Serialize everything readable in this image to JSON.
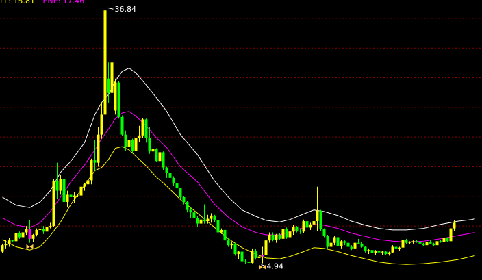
{
  "legend": {
    "items": [
      {
        "label": "LL: 15.81",
        "color": "#ffff00"
      },
      {
        "label": "ENE: 17.46",
        "color": "#ff00ff"
      }
    ]
  },
  "chart_data": {
    "type": "candlestick",
    "ylim": [
      3.2,
      37.8
    ],
    "grid": true,
    "colors": {
      "up": "#ffff00",
      "down": "#00ff00",
      "upper_band": "#ffffff",
      "middle_band": "#ff00ff",
      "lower_band": "#ffff00",
      "grid": "#8b0000",
      "signal": "#ff00ff"
    },
    "annotations": {
      "max": {
        "label": "36.84",
        "value": 36.84,
        "index": 30
      },
      "min": {
        "label": "4.94",
        "value": 4.94,
        "index": 76
      }
    },
    "signal_marks": [
      8,
      76
    ],
    "candles": [
      [
        6.4,
        7.4,
        6.2,
        7.2
      ],
      [
        7.2,
        7.9,
        6.8,
        7.3
      ],
      [
        7.3,
        8.1,
        7.0,
        7.8
      ],
      [
        7.8,
        7.9,
        7.6,
        7.7
      ],
      [
        7.7,
        8.9,
        7.5,
        8.7
      ],
      [
        8.7,
        8.9,
        8.0,
        8.2
      ],
      [
        8.2,
        9.0,
        8.0,
        8.8
      ],
      [
        8.8,
        9.6,
        8.5,
        9.2
      ],
      [
        9.2,
        10.3,
        7.5,
        8.0
      ],
      [
        8.0,
        8.6,
        7.6,
        8.5
      ],
      [
        8.5,
        9.3,
        8.3,
        9.1
      ],
      [
        9.1,
        9.5,
        8.9,
        9.2
      ],
      [
        9.2,
        9.6,
        8.6,
        8.9
      ],
      [
        8.9,
        9.6,
        8.8,
        9.5
      ],
      [
        9.5,
        10.0,
        9.3,
        9.6
      ],
      [
        9.6,
        15.5,
        9.5,
        15.2
      ],
      [
        15.2,
        17.5,
        13.0,
        14.0
      ],
      [
        14.0,
        16.0,
        13.5,
        15.5
      ],
      [
        15.5,
        15.6,
        12.3,
        12.6
      ],
      [
        12.6,
        14.0,
        12.0,
        13.5
      ],
      [
        13.5,
        14.2,
        13.0,
        13.2
      ],
      [
        13.2,
        13.8,
        12.5,
        13.4
      ],
      [
        13.4,
        13.6,
        13.2,
        13.4
      ],
      [
        13.4,
        15.0,
        13.0,
        14.5
      ],
      [
        14.5,
        15.0,
        14.0,
        14.8
      ],
      [
        14.8,
        15.5,
        14.5,
        15.3
      ],
      [
        15.3,
        18.0,
        14.8,
        17.8
      ],
      [
        17.8,
        20.3,
        16.5,
        17.5
      ],
      [
        17.5,
        22.0,
        17.0,
        21.0
      ],
      [
        21.0,
        25.0,
        20.5,
        23.5
      ],
      [
        23.5,
        37.0,
        23.0,
        36.5
      ],
      [
        28.0,
        30.0,
        25.0,
        26.2
      ],
      [
        26.2,
        30.5,
        25.8,
        30.0
      ],
      [
        24.0,
        28.0,
        23.5,
        27.5
      ],
      [
        27.5,
        27.7,
        23.0,
        23.2
      ],
      [
        23.2,
        23.4,
        20.8,
        21.0
      ],
      [
        21.0,
        21.5,
        19.0,
        19.5
      ],
      [
        19.5,
        21.0,
        18.0,
        20.3
      ],
      [
        20.3,
        20.5,
        18.7,
        19.0
      ],
      [
        19.0,
        20.8,
        18.6,
        20.6
      ],
      [
        20.6,
        22.1,
        20.1,
        20.9
      ],
      [
        20.9,
        23.1,
        20.6,
        22.9
      ],
      [
        22.9,
        23.0,
        20.0,
        20.6
      ],
      [
        20.6,
        22.0,
        18.6,
        18.9
      ],
      [
        18.9,
        19.4,
        18.2,
        19.2
      ],
      [
        19.2,
        19.3,
        17.6,
        17.7
      ],
      [
        17.7,
        19.0,
        17.6,
        18.8
      ],
      [
        18.8,
        18.9,
        16.6,
        16.9
      ],
      [
        16.9,
        17.0,
        15.6,
        16.2
      ],
      [
        16.2,
        16.3,
        15.3,
        15.6
      ],
      [
        15.6,
        15.8,
        14.6,
        14.9
      ],
      [
        14.9,
        15.0,
        13.8,
        14.3
      ],
      [
        14.3,
        14.4,
        12.9,
        13.2
      ],
      [
        13.2,
        13.3,
        12.3,
        12.6
      ],
      [
        12.6,
        12.7,
        11.3,
        11.6
      ],
      [
        11.6,
        11.9,
        10.6,
        11.3
      ],
      [
        11.3,
        11.5,
        10.0,
        10.6
      ],
      [
        10.6,
        10.8,
        9.5,
        9.9
      ],
      [
        9.9,
        10.6,
        9.6,
        10.4
      ],
      [
        10.4,
        12.3,
        9.9,
        10.2
      ],
      [
        10.2,
        11.0,
        9.9,
        10.5
      ],
      [
        10.5,
        11.2,
        10.0,
        10.9
      ],
      [
        10.9,
        11.0,
        10.1,
        10.3
      ],
      [
        10.3,
        10.5,
        8.6,
        8.8
      ],
      [
        8.8,
        9.3,
        8.6,
        9.1
      ],
      [
        9.1,
        9.2,
        7.6,
        7.8
      ],
      [
        7.8,
        8.1,
        7.0,
        7.2
      ],
      [
        7.2,
        7.6,
        6.8,
        7.4
      ],
      [
        7.4,
        7.5,
        5.9,
        6.1
      ],
      [
        6.1,
        6.5,
        5.5,
        6.4
      ],
      [
        6.4,
        6.6,
        5.0,
        5.2
      ],
      [
        5.2,
        5.5,
        4.9,
        5.1
      ],
      [
        5.1,
        5.3,
        4.94,
        5.0
      ],
      [
        5.0,
        6.8,
        4.94,
        6.5
      ],
      [
        6.5,
        6.7,
        5.4,
        5.6
      ],
      [
        5.6,
        6.0,
        5.3,
        5.8
      ],
      [
        5.8,
        7.0,
        4.94,
        6.0
      ],
      [
        6.0,
        8.0,
        5.8,
        7.8
      ],
      [
        7.8,
        8.8,
        7.5,
        8.5
      ],
      [
        8.5,
        8.8,
        7.7,
        7.9
      ],
      [
        7.9,
        8.6,
        7.5,
        8.5
      ],
      [
        8.5,
        8.7,
        7.9,
        8.0
      ],
      [
        8.0,
        9.5,
        7.8,
        9.2
      ],
      [
        9.2,
        9.4,
        8.0,
        8.2
      ],
      [
        8.2,
        9.1,
        8.0,
        8.9
      ],
      [
        8.9,
        9.7,
        8.5,
        9.5
      ],
      [
        9.5,
        9.6,
        8.8,
        9.0
      ],
      [
        9.0,
        9.3,
        8.6,
        8.9
      ],
      [
        8.9,
        10.4,
        8.7,
        10.2
      ],
      [
        10.2,
        10.5,
        9.2,
        9.4
      ],
      [
        9.4,
        10.0,
        9.1,
        9.8
      ],
      [
        9.8,
        10.5,
        9.5,
        10.2
      ],
      [
        10.2,
        14.5,
        9.0,
        11.5
      ],
      [
        11.5,
        11.6,
        9.0,
        9.2
      ],
      [
        9.2,
        9.3,
        8.2,
        8.4
      ],
      [
        8.4,
        8.5,
        6.8,
        7.0
      ],
      [
        7.0,
        7.8,
        6.7,
        7.5
      ],
      [
        7.5,
        8.4,
        7.2,
        8.2
      ],
      [
        8.2,
        8.3,
        7.0,
        7.1
      ],
      [
        7.1,
        7.9,
        6.8,
        7.7
      ],
      [
        7.7,
        7.8,
        7.2,
        7.5
      ],
      [
        7.5,
        7.7,
        6.9,
        7.0
      ],
      [
        7.0,
        7.2,
        6.6,
        6.8
      ],
      [
        6.8,
        7.6,
        6.7,
        7.5
      ],
      [
        7.5,
        8.0,
        7.3,
        7.4
      ],
      [
        7.4,
        7.6,
        6.9,
        7.0
      ],
      [
        7.0,
        7.1,
        6.3,
        6.5
      ],
      [
        6.5,
        6.8,
        6.1,
        6.6
      ],
      [
        6.6,
        6.7,
        6.1,
        6.2
      ],
      [
        6.2,
        6.6,
        6.0,
        6.5
      ],
      [
        6.5,
        6.6,
        6.1,
        6.3
      ],
      [
        6.3,
        6.5,
        6.0,
        6.4
      ],
      [
        6.4,
        6.5,
        6.0,
        6.1
      ],
      [
        6.1,
        6.4,
        5.9,
        6.3
      ],
      [
        6.3,
        7.2,
        6.2,
        7.0
      ],
      [
        7.0,
        7.2,
        6.6,
        6.8
      ],
      [
        6.8,
        7.0,
        6.5,
        6.9
      ],
      [
        6.9,
        8.2,
        6.8,
        7.9
      ],
      [
        7.9,
        8.0,
        7.3,
        7.5
      ],
      [
        7.5,
        7.7,
        7.3,
        7.6
      ],
      [
        7.6,
        7.8,
        7.4,
        7.7
      ],
      [
        7.7,
        7.9,
        7.5,
        7.6
      ],
      [
        7.6,
        7.8,
        7.3,
        7.4
      ],
      [
        7.4,
        7.5,
        7.1,
        7.2
      ],
      [
        7.2,
        7.7,
        7.0,
        7.6
      ],
      [
        7.6,
        7.8,
        7.3,
        7.4
      ],
      [
        7.4,
        7.5,
        7.1,
        7.2
      ],
      [
        7.2,
        7.8,
        7.1,
        7.7
      ],
      [
        7.7,
        7.9,
        7.5,
        7.6
      ],
      [
        7.6,
        8.2,
        7.5,
        8.1
      ],
      [
        8.1,
        8.2,
        7.6,
        7.7
      ],
      [
        7.7,
        9.5,
        7.6,
        9.3
      ],
      [
        9.3,
        10.3,
        9.0,
        10.0
      ]
    ],
    "bands": {
      "upper": [
        [
          0,
          13.2
        ],
        [
          4,
          12.2
        ],
        [
          8,
          11.9
        ],
        [
          11,
          12.6
        ],
        [
          14,
          14.0
        ],
        [
          17,
          16.3
        ],
        [
          20,
          17.7
        ],
        [
          24,
          20.0
        ],
        [
          27,
          23.5
        ],
        [
          29,
          25.0
        ],
        [
          31,
          26.0
        ],
        [
          33,
          27.7
        ],
        [
          35,
          28.9
        ],
        [
          37,
          29.3
        ],
        [
          39,
          28.7
        ],
        [
          42,
          27.2
        ],
        [
          45,
          25.6
        ],
        [
          48,
          23.9
        ],
        [
          52,
          21.0
        ],
        [
          57,
          18.5
        ],
        [
          62,
          15.2
        ],
        [
          66,
          13.2
        ],
        [
          70,
          11.6
        ],
        [
          74,
          10.8
        ],
        [
          77,
          10.3
        ],
        [
          81,
          10.1
        ],
        [
          84,
          10.4
        ],
        [
          88,
          11.1
        ],
        [
          91,
          11.6
        ],
        [
          94,
          11.4
        ],
        [
          98,
          10.9
        ],
        [
          102,
          10.2
        ],
        [
          106,
          9.7
        ],
        [
          110,
          9.3
        ],
        [
          114,
          9.1
        ],
        [
          118,
          9.1
        ],
        [
          123,
          9.3
        ],
        [
          128,
          9.8
        ],
        [
          133,
          10.2
        ],
        [
          137,
          10.4
        ],
        [
          138,
          10.5
        ]
      ],
      "middle": [
        [
          0,
          10.6
        ],
        [
          4,
          9.7
        ],
        [
          8,
          9.4
        ],
        [
          11,
          10.0
        ],
        [
          14,
          11.4
        ],
        [
          17,
          13.2
        ],
        [
          20,
          15.1
        ],
        [
          24,
          17.2
        ],
        [
          27,
          19.1
        ],
        [
          29,
          20.5
        ],
        [
          31,
          21.7
        ],
        [
          33,
          23.0
        ],
        [
          35,
          23.7
        ],
        [
          37,
          23.9
        ],
        [
          39,
          23.3
        ],
        [
          42,
          22.1
        ],
        [
          45,
          20.6
        ],
        [
          48,
          19.4
        ],
        [
          52,
          17.0
        ],
        [
          57,
          15.1
        ],
        [
          62,
          12.3
        ],
        [
          66,
          10.7
        ],
        [
          70,
          9.5
        ],
        [
          74,
          8.8
        ],
        [
          77,
          8.5
        ],
        [
          81,
          8.5
        ],
        [
          84,
          8.9
        ],
        [
          88,
          9.4
        ],
        [
          91,
          9.8
        ],
        [
          94,
          9.7
        ],
        [
          98,
          9.3
        ],
        [
          102,
          8.7
        ],
        [
          106,
          8.3
        ],
        [
          110,
          7.9
        ],
        [
          114,
          7.7
        ],
        [
          118,
          7.6
        ],
        [
          123,
          7.7
        ],
        [
          128,
          8.0
        ],
        [
          133,
          8.4
        ],
        [
          137,
          8.7
        ],
        [
          138,
          8.8
        ]
      ],
      "lower": [
        [
          0,
          7.9
        ],
        [
          4,
          7.0
        ],
        [
          8,
          6.6
        ],
        [
          11,
          7.0
        ],
        [
          14,
          8.4
        ],
        [
          17,
          10.1
        ],
        [
          20,
          12.3
        ],
        [
          24,
          14.7
        ],
        [
          27,
          16.5
        ],
        [
          29,
          16.9
        ],
        [
          31,
          17.9
        ],
        [
          33,
          19.3
        ],
        [
          35,
          19.5
        ],
        [
          37,
          19.1
        ],
        [
          39,
          18.3
        ],
        [
          42,
          17.1
        ],
        [
          45,
          15.7
        ],
        [
          48,
          14.6
        ],
        [
          52,
          12.9
        ],
        [
          57,
          11.2
        ],
        [
          62,
          9.4
        ],
        [
          66,
          8.0
        ],
        [
          70,
          6.9
        ],
        [
          74,
          6.1
        ],
        [
          77,
          5.6
        ],
        [
          81,
          5.5
        ],
        [
          84,
          5.8
        ],
        [
          88,
          6.4
        ],
        [
          91,
          6.9
        ],
        [
          94,
          6.8
        ],
        [
          98,
          6.4
        ],
        [
          102,
          5.9
        ],
        [
          106,
          5.5
        ],
        [
          110,
          5.1
        ],
        [
          114,
          4.9
        ],
        [
          118,
          4.8
        ],
        [
          123,
          4.9
        ],
        [
          128,
          5.1
        ],
        [
          133,
          5.4
        ],
        [
          137,
          5.8
        ],
        [
          138,
          5.9
        ]
      ]
    }
  }
}
